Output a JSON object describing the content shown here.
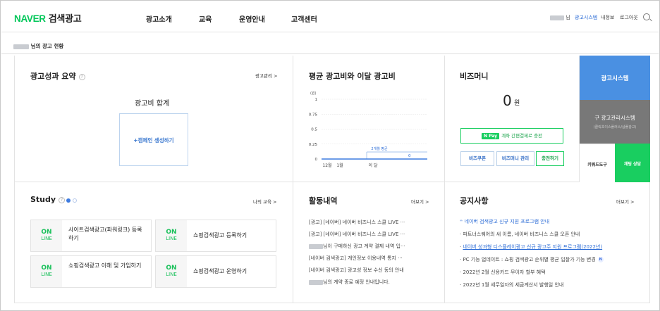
{
  "header": {
    "logo_brand": "NAVER",
    "logo_product": "검색광고",
    "nav": [
      "광고소개",
      "교육",
      "운영안내",
      "고객센터"
    ],
    "user_suffix": "님",
    "ad_system_link": "광고시스템",
    "my_info": "내정보",
    "logout": "로그아웃"
  },
  "status": {
    "title": "님의 광고 현황"
  },
  "summary": {
    "title": "광고성과 요약",
    "manage_link": "광고관리 >",
    "total_label": "광고비 합계",
    "create_campaign": "+캠페인 생성하기"
  },
  "chart_data": {
    "type": "bar",
    "title": "평균 광고비와 이달 광고비",
    "unit_label": "(원)",
    "y_ticks": [
      "1",
      "0.75",
      "0.5",
      "0.25",
      "0"
    ],
    "ylim": [
      0,
      1
    ],
    "categories": [
      "12월",
      "1월",
      "이 달"
    ],
    "series": [
      {
        "name": "2개월 평균",
        "values": [
          0,
          0,
          0
        ]
      },
      {
        "name": "",
        "values": [
          0,
          0,
          0
        ]
      }
    ],
    "annotation_label": "2개월 평균",
    "annotation_value": "0"
  },
  "bizmoney": {
    "title": "비즈머니",
    "amount": "0",
    "unit": "원",
    "npay_badge": "N Pay",
    "npay_text": "계좌 간편결제로 충전",
    "buttons": [
      "비즈쿠폰",
      "비즈머니 관리",
      "충전하기"
    ]
  },
  "tiles": {
    "ad_system": "광고시스템",
    "old_system": "구 광고관리시스템",
    "old_system_sub": "(클릭초이스플러스/샵플광고)",
    "keyword_tool": "키워드도구",
    "chat": "채팅 상담"
  },
  "study": {
    "title": "Study",
    "more": "나의 교육 >",
    "on": "ON",
    "line": "LINE",
    "cards": [
      "사이트검색광고(파워링크) 등록하기",
      "쇼핑검색광고 등록하기",
      "쇼핑검색광고 이해 및 가입하기",
      "쇼핑검색광고 운영하기"
    ]
  },
  "activity": {
    "title": "활동내역",
    "more": "더보기 >",
    "items": [
      "[광고] [네이버] 네이버 비즈니스 스쿨 LIVE ···",
      "[광고] [네이버] 네이버 비즈니스 스쿨 LIVE ···",
      "님이 구매하신 광고 계약 결제 내역 입···",
      "[네이버 검색광고] 개인정보 이용내역 통지 ···",
      "[네이버 검색광고] 광고성 정보 수신 동의 안내",
      "님의 계약 종료 예정 안내입니다."
    ]
  },
  "notice": {
    "title": "공지사항",
    "more": "더보기 >",
    "items": [
      "네이버 검색광고 신규 지원 프로그램 안내",
      "파트너스퀘어의 새 이름, 네이버 비즈니스 스쿨 오픈 안내",
      "네이버 성과형 디스플레이광고 신규 광고주 지원 프로그램(2022년)",
      "PC 기능 업데이트 : 쇼핑 검색광고 순위별 평균 입찰가 기능 변경",
      "2022년 2월 신용카드 무이자 할부 혜택",
      "2022년 1월 세무일자의 세금계산서 발행일 안내"
    ]
  },
  "colors": {
    "naver_green": "#03c75a",
    "blue_tile": "#4a90e2",
    "gray_tile": "#787878",
    "link_blue": "#2c6cd6"
  }
}
